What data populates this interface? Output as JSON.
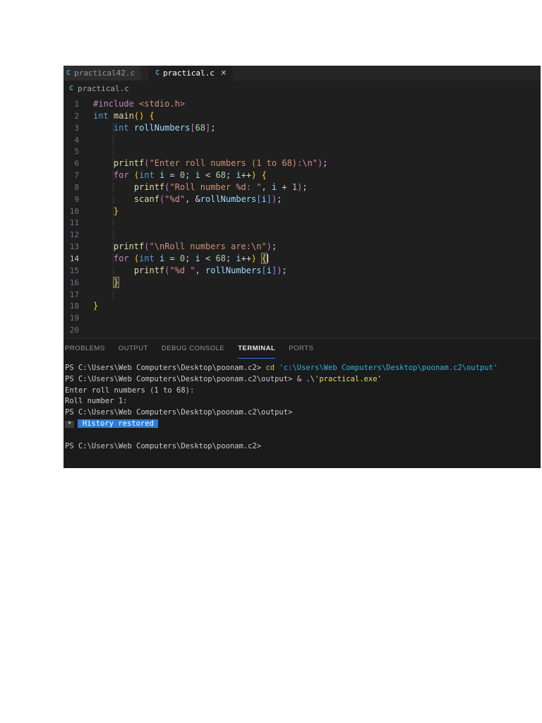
{
  "tab_bar": {
    "tabs": [
      {
        "label": "practical42.c",
        "active": false
      },
      {
        "label": "practical.c",
        "active": true
      }
    ],
    "close_glyph": "×",
    "file_icon_glyph": "C"
  },
  "breadcrumb": {
    "file": "practical.c"
  },
  "editor": {
    "active_line": 14,
    "lines": [
      {
        "n": "1",
        "t": [
          [
            "kw",
            "#include"
          ],
          [
            "pl",
            " "
          ],
          [
            "str",
            "<stdio.h>"
          ]
        ]
      },
      {
        "n": "2",
        "t": [
          [
            "type",
            "int"
          ],
          [
            "pl",
            " "
          ],
          [
            "fn",
            "main"
          ],
          [
            "b1",
            "()"
          ],
          [
            "pl",
            " "
          ],
          [
            "b1",
            "{"
          ]
        ]
      },
      {
        "n": "3",
        "t": [
          [
            "gd",
            "    "
          ],
          [
            "type",
            "int"
          ],
          [
            "pl",
            " "
          ],
          [
            "var",
            "rollNumbers"
          ],
          [
            "b2",
            "["
          ],
          [
            "num",
            "68"
          ],
          [
            "b2",
            "]"
          ],
          [
            "pl",
            ";"
          ]
        ]
      },
      {
        "n": "4",
        "t": [
          [
            "gd",
            "    "
          ]
        ]
      },
      {
        "n": "5",
        "t": [
          [
            "gd",
            "    "
          ]
        ]
      },
      {
        "n": "6",
        "t": [
          [
            "gd",
            "    "
          ],
          [
            "fn",
            "printf"
          ],
          [
            "b2",
            "("
          ],
          [
            "str",
            "\"Enter roll numbers (1 to 68):"
          ],
          [
            "esc",
            "\\n"
          ],
          [
            "str",
            "\""
          ],
          [
            "b2",
            ")"
          ],
          [
            "pl",
            ";"
          ]
        ]
      },
      {
        "n": "7",
        "t": [
          [
            "gd",
            "    "
          ],
          [
            "kw",
            "for"
          ],
          [
            "pl",
            " "
          ],
          [
            "b1",
            "("
          ],
          [
            "type",
            "int"
          ],
          [
            "pl",
            " "
          ],
          [
            "var",
            "i"
          ],
          [
            "pl",
            " = "
          ],
          [
            "num",
            "0"
          ],
          [
            "pl",
            "; "
          ],
          [
            "var",
            "i"
          ],
          [
            "pl",
            " < "
          ],
          [
            "num",
            "68"
          ],
          [
            "pl",
            "; "
          ],
          [
            "var",
            "i"
          ],
          [
            "pl",
            "++"
          ],
          [
            "b1",
            ")"
          ],
          [
            "pl",
            " "
          ],
          [
            "b1",
            "{"
          ]
        ]
      },
      {
        "n": "8",
        "t": [
          [
            "gd",
            "    "
          ],
          [
            "pl",
            "    "
          ],
          [
            "fn",
            "printf"
          ],
          [
            "b2",
            "("
          ],
          [
            "str",
            "\"Roll number "
          ],
          [
            "esc",
            "%d"
          ],
          [
            "str",
            ": \""
          ],
          [
            "pl",
            ", "
          ],
          [
            "var",
            "i"
          ],
          [
            "pl",
            " + "
          ],
          [
            "num",
            "1"
          ],
          [
            "b2",
            ")"
          ],
          [
            "pl",
            ";"
          ]
        ]
      },
      {
        "n": "9",
        "t": [
          [
            "gd",
            "    "
          ],
          [
            "pl",
            "    "
          ],
          [
            "fn",
            "scanf"
          ],
          [
            "b2",
            "("
          ],
          [
            "str",
            "\""
          ],
          [
            "esc",
            "%d"
          ],
          [
            "str",
            "\""
          ],
          [
            "pl",
            ", &"
          ],
          [
            "var",
            "rollNumbers"
          ],
          [
            "b3",
            "["
          ],
          [
            "var",
            "i"
          ],
          [
            "b3",
            "]"
          ],
          [
            "b2",
            ")"
          ],
          [
            "pl",
            ";"
          ]
        ]
      },
      {
        "n": "10",
        "t": [
          [
            "gd",
            "    "
          ],
          [
            "b1",
            "}"
          ]
        ]
      },
      {
        "n": "11",
        "t": [
          [
            "gd",
            "    "
          ]
        ]
      },
      {
        "n": "12",
        "t": [
          [
            "gd",
            "    "
          ]
        ]
      },
      {
        "n": "13",
        "t": [
          [
            "gd",
            "    "
          ],
          [
            "fn",
            "printf"
          ],
          [
            "b2",
            "("
          ],
          [
            "str",
            "\""
          ],
          [
            "esc",
            "\\n"
          ],
          [
            "str",
            "Roll numbers are:"
          ],
          [
            "esc",
            "\\n"
          ],
          [
            "str",
            "\""
          ],
          [
            "b2",
            ")"
          ],
          [
            "pl",
            ";"
          ]
        ]
      },
      {
        "n": "14",
        "t": [
          [
            "gd",
            "    "
          ],
          [
            "kw",
            "for"
          ],
          [
            "pl",
            " "
          ],
          [
            "b1",
            "("
          ],
          [
            "type",
            "int"
          ],
          [
            "pl",
            " "
          ],
          [
            "var",
            "i"
          ],
          [
            "pl",
            " = "
          ],
          [
            "num",
            "0"
          ],
          [
            "pl",
            "; "
          ],
          [
            "var",
            "i"
          ],
          [
            "pl",
            " < "
          ],
          [
            "num",
            "68"
          ],
          [
            "pl",
            "; "
          ],
          [
            "var",
            "i"
          ],
          [
            "pl",
            "++"
          ],
          [
            "b1",
            ")"
          ],
          [
            "pl",
            " "
          ],
          [
            "b1 boxed",
            "{"
          ],
          [
            "caret",
            ""
          ]
        ]
      },
      {
        "n": "15",
        "t": [
          [
            "gd",
            "    "
          ],
          [
            "pl",
            "    "
          ],
          [
            "fn",
            "printf"
          ],
          [
            "b2",
            "("
          ],
          [
            "str",
            "\""
          ],
          [
            "esc",
            "%d"
          ],
          [
            "str",
            " \""
          ],
          [
            "pl",
            ", "
          ],
          [
            "var",
            "rollNumbers"
          ],
          [
            "b3",
            "["
          ],
          [
            "var",
            "i"
          ],
          [
            "b3",
            "]"
          ],
          [
            "b2",
            ")"
          ],
          [
            "pl",
            ";"
          ]
        ]
      },
      {
        "n": "16",
        "t": [
          [
            "gd",
            "    "
          ],
          [
            "b1 boxed",
            "}"
          ]
        ]
      },
      {
        "n": "17",
        "t": [
          [
            "gd",
            "    "
          ]
        ]
      },
      {
        "n": "18",
        "t": [
          [
            "b1",
            "}"
          ]
        ]
      },
      {
        "n": "19",
        "t": []
      },
      {
        "n": "20",
        "t": []
      }
    ]
  },
  "panel": {
    "tabs": [
      {
        "label": "PROBLEMS",
        "active": false
      },
      {
        "label": "OUTPUT",
        "active": false
      },
      {
        "label": "DEBUG CONSOLE",
        "active": false
      },
      {
        "label": "TERMINAL",
        "active": true
      },
      {
        "label": "PORTS",
        "active": false
      }
    ]
  },
  "terminal": {
    "lines": [
      {
        "t": [
          [
            "t",
            "PS C:\\Users\\Web Computers\\Desktop\\poonam.c2> "
          ],
          [
            "cmd",
            "cd"
          ],
          [
            "t",
            " "
          ],
          [
            "path",
            "'c:\\Users\\Web Computers\\Desktop\\poonam.c2\\output'"
          ]
        ]
      },
      {
        "t": [
          [
            "t",
            "PS C:\\Users\\Web Computers\\Desktop\\poonam.c2\\output> & .\\"
          ],
          [
            "exe",
            "'practical.exe'"
          ]
        ]
      },
      {
        "t": [
          [
            "t",
            "Enter roll numbers (1 to 68):"
          ]
        ]
      },
      {
        "t": [
          [
            "t",
            "Roll number 1:"
          ]
        ]
      },
      {
        "t": [
          [
            "t",
            "PS C:\\Users\\Web Computers\\Desktop\\poonam.c2\\output>"
          ]
        ]
      },
      {
        "t": [
          [
            "star",
            "*"
          ],
          [
            "sel",
            " History restored "
          ]
        ]
      },
      {
        "t": []
      },
      {
        "t": [
          [
            "t",
            "PS C:\\Users\\Web Computers\\Desktop\\poonam.c2>"
          ]
        ]
      }
    ]
  },
  "colors": {
    "editor_bg": "#1f1f1f",
    "tabbar_bg": "#252526",
    "inactive_tab_bg": "#2d2d2e",
    "accent_underline": "#2e7bd6",
    "selection_blue": "#2e7bd6",
    "c_icon_blue": "#519aba",
    "keyword": "#C586C0",
    "type": "#569CD6",
    "function": "#DCDCAA",
    "variable": "#9CDCFE",
    "string": "#CE9178",
    "number": "#B5CEA8",
    "format_specifier": "#d98f8f",
    "terminal_fg": "#cccccc",
    "terminal_path_cyan": "#29b8db",
    "terminal_cmd_yellow": "#c8c868"
  }
}
